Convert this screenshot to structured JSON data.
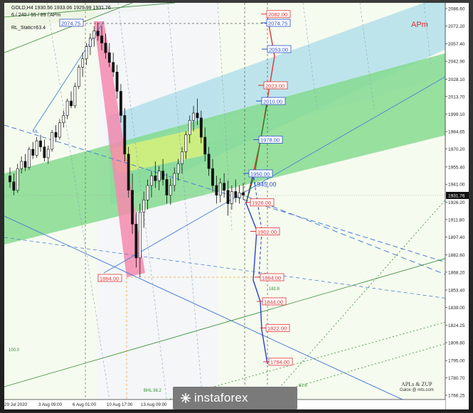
{
  "header": {
    "symbol_line": "GOLD,H4  1930.56 1933.06 1929.99 1931.76",
    "settings_line": "6 / 240 / 55 / 89 / APm",
    "indicator_line": "RL_Static=63.4"
  },
  "watermark": {
    "brand": "instaforex"
  },
  "credits": {
    "line1": "APLs & ZUP",
    "line2": "Galox @ mts.com"
  },
  "apm_label": "APm",
  "chart_data": {
    "type": "candlestick",
    "symbol": "GOLD",
    "timeframe": "H4",
    "ylim": [
      1766.25,
      2086.6
    ],
    "price_axis_ticks": [
      2086.6,
      2072.2,
      2057.4,
      2042.9,
      2028.1,
      2013.7,
      1999.1,
      1984.65,
      1970.2,
      1955.4,
      1941.0,
      1926.2,
      1911.8,
      1897.4,
      1882.6,
      1868.2,
      1853.4,
      1839.0,
      1824.25,
      1809.8,
      1795.0,
      1780.7,
      1766.25
    ],
    "current_price": 1931.76,
    "time_axis_labels": [
      "29 Jul 2020",
      "3 Aug 09:00",
      "6 Aug 01:00",
      "10 Aug 17:00",
      "13 Aug 09:00"
    ],
    "level_labels": [
      {
        "value": "2082.00",
        "color": "#e03030"
      },
      {
        "value": "2074.75",
        "color": "#2a4fd0"
      },
      {
        "value": "2053.00",
        "color": "#2a4fd0"
      },
      {
        "value": "2023.00",
        "color": "#e03030"
      },
      {
        "value": "2010.00",
        "color": "#2a4fd0"
      },
      {
        "value": "1978.00",
        "color": "#2a4fd0"
      },
      {
        "value": "1950.00",
        "color": "#2a4fd0"
      },
      {
        "value": "1926.00",
        "color": "#e03030"
      },
      {
        "value": "1902.00",
        "color": "#e03030"
      },
      {
        "value": "1864.00",
        "color": "#e03030"
      },
      {
        "value": "1844.00",
        "color": "#e03030"
      },
      {
        "value": "1822.00",
        "color": "#e03030"
      },
      {
        "value": "1794.00",
        "color": "#e03030"
      }
    ],
    "marker_labels": [
      {
        "text": "2074.75",
        "price": 2074.75,
        "color": "#2a4fd0"
      },
      {
        "text": "1864.00",
        "price": 1864.0,
        "color": "#e03030"
      },
      {
        "text": "1945.00",
        "price": 1945.0,
        "color": "#2a4fd0"
      }
    ],
    "line_labels": [
      "BHL 38.2",
      "61.8",
      "100.0",
      "161.8",
      "ML"
    ],
    "candles": [
      [
        1948,
        1955,
        1938,
        1943
      ],
      [
        1943,
        1950,
        1932,
        1936
      ],
      [
        1936,
        1958,
        1934,
        1954
      ],
      [
        1954,
        1964,
        1950,
        1960
      ],
      [
        1960,
        1966,
        1952,
        1955
      ],
      [
        1955,
        1972,
        1953,
        1970
      ],
      [
        1970,
        1976,
        1962,
        1965
      ],
      [
        1965,
        1980,
        1963,
        1977
      ],
      [
        1977,
        1982,
        1968,
        1972
      ],
      [
        1972,
        1978,
        1960,
        1963
      ],
      [
        1963,
        1973,
        1958,
        1970
      ],
      [
        1970,
        1986,
        1968,
        1984
      ],
      [
        1984,
        1990,
        1976,
        1980
      ],
      [
        1980,
        1995,
        1978,
        1992
      ],
      [
        1992,
        2002,
        1988,
        1998
      ],
      [
        1998,
        2012,
        1995,
        2010
      ],
      [
        2010,
        2018,
        2004,
        2006
      ],
      [
        2006,
        2025,
        2004,
        2022
      ],
      [
        2022,
        2040,
        2020,
        2038
      ],
      [
        2038,
        2050,
        2030,
        2045
      ],
      [
        2045,
        2058,
        2040,
        2055
      ],
      [
        2055,
        2066,
        2048,
        2062
      ],
      [
        2062,
        2072,
        2055,
        2068
      ],
      [
        2068,
        2075,
        2060,
        2064
      ],
      [
        2064,
        2072,
        2052,
        2058
      ],
      [
        2058,
        2066,
        2045,
        2050
      ],
      [
        2050,
        2058,
        2038,
        2042
      ],
      [
        2042,
        2050,
        2030,
        2034
      ],
      [
        2034,
        2040,
        2012,
        2018
      ],
      [
        2018,
        2024,
        1992,
        1998
      ],
      [
        1998,
        2004,
        1960,
        1966
      ],
      [
        1966,
        1972,
        1930,
        1936
      ],
      [
        1936,
        1950,
        1900,
        1908
      ],
      [
        1908,
        1918,
        1872,
        1880
      ],
      [
        1880,
        1925,
        1864,
        1918
      ],
      [
        1918,
        1935,
        1905,
        1928
      ],
      [
        1928,
        1945,
        1920,
        1940
      ],
      [
        1940,
        1952,
        1930,
        1948
      ],
      [
        1948,
        1960,
        1938,
        1944
      ],
      [
        1944,
        1956,
        1936,
        1952
      ],
      [
        1952,
        1962,
        1940,
        1945
      ],
      [
        1945,
        1950,
        1925,
        1932
      ],
      [
        1932,
        1946,
        1924,
        1940
      ],
      [
        1940,
        1955,
        1935,
        1950
      ],
      [
        1950,
        1962,
        1944,
        1958
      ],
      [
        1958,
        1972,
        1950,
        1968
      ],
      [
        1968,
        1985,
        1962,
        1982
      ],
      [
        1982,
        1998,
        1975,
        1994
      ],
      [
        1994,
        2006,
        1985,
        2000
      ],
      [
        2000,
        2012,
        1990,
        1996
      ],
      [
        1996,
        2002,
        1975,
        1980
      ],
      [
        1980,
        1988,
        1960,
        1966
      ],
      [
        1966,
        1972,
        1948,
        1954
      ],
      [
        1954,
        1962,
        1935,
        1940
      ],
      [
        1940,
        1948,
        1925,
        1932
      ],
      [
        1932,
        1946,
        1926,
        1942
      ],
      [
        1942,
        1950,
        1930,
        1936
      ],
      [
        1936,
        1944,
        1915,
        1925
      ],
      [
        1925,
        1940,
        1920,
        1935
      ],
      [
        1935,
        1945,
        1926,
        1930
      ],
      [
        1930,
        1940,
        1925,
        1934
      ],
      [
        1934,
        1942,
        1928,
        1932
      ]
    ]
  }
}
